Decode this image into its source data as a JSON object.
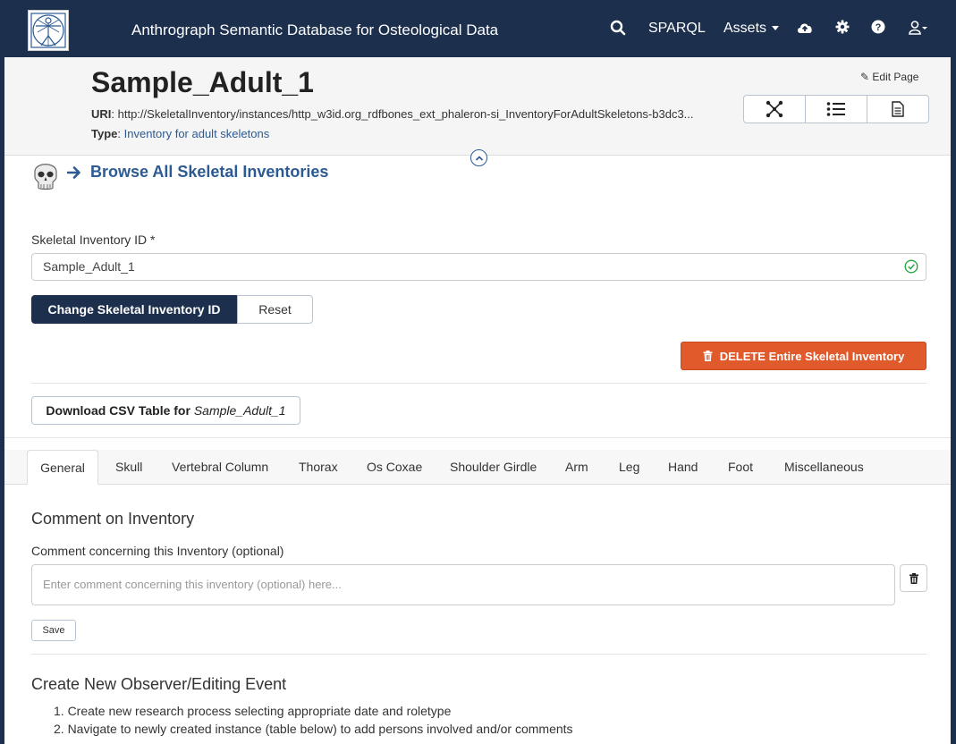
{
  "navbar": {
    "brand": "Anthrograph Semantic Database for Osteological Data",
    "sparql": "SPARQL",
    "assets": "Assets"
  },
  "header": {
    "title": "Sample_Adult_1",
    "uri_label": "URI",
    "uri_value": "http://SkeletalInventory/instances/http_w3id.org_rdfbones_ext_phaleron-si_InventoryForAdultSkeletons-b3dc3...",
    "type_label": "Type",
    "type_value": "Inventory for adult skeletons",
    "edit_page": "Edit Page"
  },
  "browse": {
    "label": "Browse All Skeletal Inventories"
  },
  "form": {
    "id_label": "Skeletal Inventory ID *",
    "id_value": "Sample_Adult_1",
    "change_button": "Change Skeletal Inventory ID",
    "reset_button": "Reset",
    "delete_button": "DELETE Entire Skeletal Inventory",
    "csv_prefix": "Download CSV Table for ",
    "csv_name": "Sample_Adult_1"
  },
  "tabs": [
    "General",
    "Skull",
    "Vertebral Column",
    "Thorax",
    "Os Coxae",
    "Shoulder Girdle",
    "Arm",
    "Leg",
    "Hand",
    "Foot",
    "Miscellaneous"
  ],
  "comment": {
    "heading": "Comment on Inventory",
    "label": "Comment concerning this Inventory (optional)",
    "placeholder": "Enter comment concerning this inventory (optional) here...",
    "save": "Save"
  },
  "observer": {
    "heading": "Create New Observer/Editing Event",
    "steps": [
      "1. Create new research process selecting appropriate date and roletype",
      "2. Navigate to newly created instance (table below) to add persons involved and/or comments"
    ]
  },
  "colors": {
    "navbar": "#1c2f4d",
    "link": "#2c5a92",
    "delete": "#e05a2b",
    "success": "#28a745"
  }
}
